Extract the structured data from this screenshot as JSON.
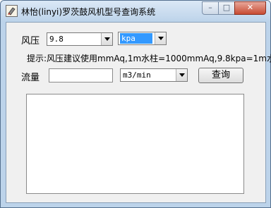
{
  "window": {
    "title": "林怡(linyi)罗茨鼓风机型号查询系统",
    "min_label": "–",
    "max_label": "□",
    "close_label": "✕"
  },
  "pressure": {
    "label": "风压",
    "value": "9.8",
    "unit": "kpa"
  },
  "hint": "提示:风压建议使用mmAq,1m水柱=1000mmAq,9.8kpa=1m水柱",
  "flow": {
    "label": "流量",
    "value": "",
    "unit": "m3/min"
  },
  "query_button": "查询",
  "result": ""
}
